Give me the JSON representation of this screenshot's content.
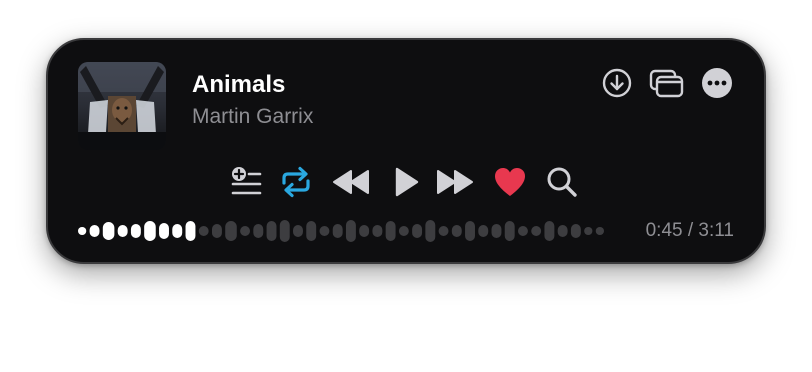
{
  "track": {
    "title": "Animals",
    "artist": "Martin Garrix",
    "time_display": "0:45 / 3:11",
    "progress": 0.236
  },
  "icons": {
    "download": "download-icon",
    "miniplayer": "miniplayer-icon",
    "more": "more-icon",
    "queue": "add-to-queue-icon",
    "repeat": "repeat-icon",
    "rewind": "rewind-icon",
    "play": "play-icon",
    "forward": "fast-forward-icon",
    "like": "heart-icon",
    "search": "search-icon"
  },
  "state": {
    "repeat_active": true,
    "liked": true
  },
  "colors": {
    "background": "#0e0e10",
    "accent": "#2aa8e0",
    "heart": "#e8384f",
    "played_wave": "#ffffff",
    "unplayed_wave": "#3d3d40",
    "secondary_text": "#8e8e93"
  }
}
